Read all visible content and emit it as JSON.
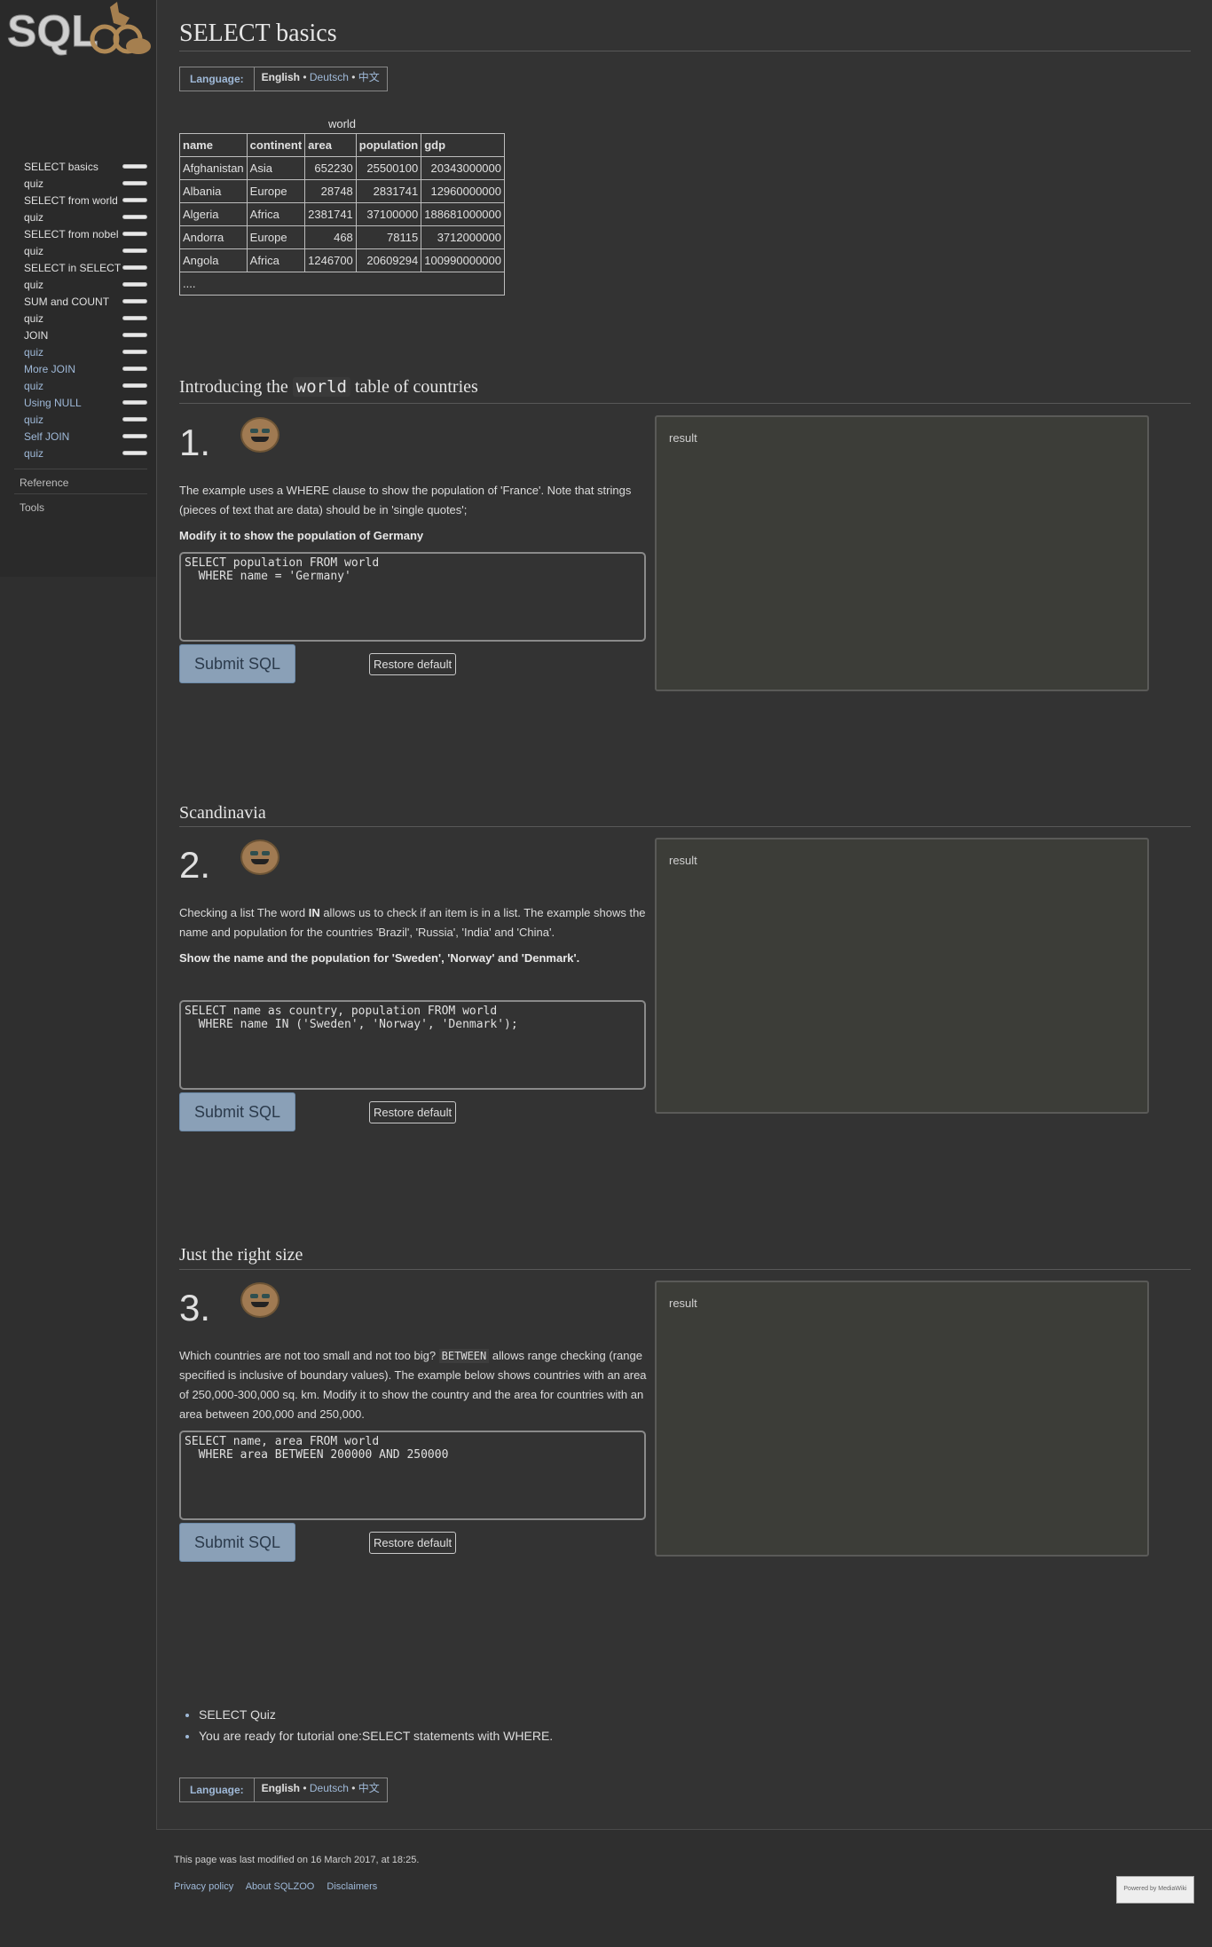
{
  "brand": {
    "logo_text": "SQL ZOO"
  },
  "sidebar": {
    "items": [
      {
        "label": "SELECT basics",
        "type": "current",
        "progress": 1
      },
      {
        "label": "quiz",
        "type": "current",
        "progress": 1
      },
      {
        "label": "SELECT from world",
        "type": "current",
        "progress": 1
      },
      {
        "label": "quiz",
        "type": "current",
        "progress": 1
      },
      {
        "label": "SELECT from nobel",
        "type": "current",
        "progress": 1
      },
      {
        "label": "quiz",
        "type": "current",
        "progress": 1
      },
      {
        "label": "SELECT in SELECT",
        "type": "current",
        "progress": 1
      },
      {
        "label": "quiz",
        "type": "current",
        "progress": 1
      },
      {
        "label": "SUM and COUNT",
        "type": "current",
        "progress": 1
      },
      {
        "label": "quiz",
        "type": "current",
        "progress": 1
      },
      {
        "label": "JOIN",
        "type": "current",
        "progress": 1
      },
      {
        "label": "quiz",
        "type": "link",
        "progress": 1
      },
      {
        "label": "More JOIN",
        "type": "link",
        "progress": 1
      },
      {
        "label": "quiz",
        "type": "link",
        "progress": 1
      },
      {
        "label": "Using NULL",
        "type": "link",
        "progress": 1
      },
      {
        "label": "quiz",
        "type": "link",
        "progress": 1
      },
      {
        "label": "Self JOIN",
        "type": "link",
        "progress": 1
      },
      {
        "label": "quiz",
        "type": "link",
        "progress": 1
      }
    ],
    "reference": "Reference",
    "tools": "Tools"
  },
  "page": {
    "title": "SELECT basics"
  },
  "language": {
    "label": "Language:",
    "current": "English",
    "sep1": " • ",
    "other1": "Deutsch",
    "sep2": " • ",
    "other2": "中文"
  },
  "world_table": {
    "caption": "world",
    "headers": [
      "name",
      "continent",
      "area",
      "population",
      "gdp"
    ],
    "rows": [
      [
        "Afghanistan",
        "Asia",
        "652230",
        "25500100",
        "20343000000"
      ],
      [
        "Albania",
        "Europe",
        "28748",
        "2831741",
        "12960000000"
      ],
      [
        "Algeria",
        "Africa",
        "2381741",
        "37100000",
        "188681000000"
      ],
      [
        "Andorra",
        "Europe",
        "468",
        "78115",
        "3712000000"
      ],
      [
        "Angola",
        "Africa",
        "1246700",
        "20609294",
        "100990000000"
      ]
    ],
    "more": "...."
  },
  "sections": [
    {
      "heading_pre": "Introducing the ",
      "heading_code": "world",
      "heading_post": " table of countries",
      "number": "1.",
      "text": "The example uses a WHERE clause to show the population of 'France'. Note that strings (pieces of text that are data) should be in 'single quotes';",
      "task": "Modify it to show the population of Germany",
      "sql": "SELECT population FROM world\n  WHERE name = 'Germany'",
      "submit": "Submit SQL",
      "restore": "Restore default",
      "result": "result"
    },
    {
      "heading": "Scandinavia",
      "number": "2.",
      "text_pre": "Checking a list The word ",
      "text_bold": "IN",
      "text_post": " allows us to check if an item is in a list. The example shows the name and population for the countries 'Brazil', 'Russia', 'India' and 'China'.",
      "task": "Show the name and the population for 'Sweden', 'Norway' and 'Denmark'.",
      "sql": "SELECT name as country, population FROM world\n  WHERE name IN ('Sweden', 'Norway', 'Denmark');",
      "submit": "Submit SQL",
      "restore": "Restore default",
      "result": "result"
    },
    {
      "heading": "Just the right size",
      "number": "3.",
      "text_pre": "Which countries are not too small and not too big? ",
      "text_code": "BETWEEN",
      "text_post": " allows range checking (range specified is inclusive of boundary values). The example below shows countries with an area of 250,000-300,000 sq. km. Modify it to show the country and the area for countries with an area between 200,000 and 250,000.",
      "sql": "SELECT name, area FROM world\n  WHERE area BETWEEN 200000 AND 250000",
      "submit": "Submit SQL",
      "restore": "Restore default",
      "result": "result"
    }
  ],
  "bottom_links": [
    "SELECT Quiz",
    "You are ready for tutorial one:SELECT statements with WHERE."
  ],
  "footer": {
    "modified": "This page was last modified on 16 March 2017, at 18:25.",
    "links": [
      "Privacy policy",
      "About SQLZOO",
      "Disclaimers"
    ],
    "badge": "Powered by MediaWiki"
  },
  "colors": {
    "link": "#9fb9d8",
    "submit_bg": "#8aa0b7",
    "result_bg": "#3c3d38"
  }
}
